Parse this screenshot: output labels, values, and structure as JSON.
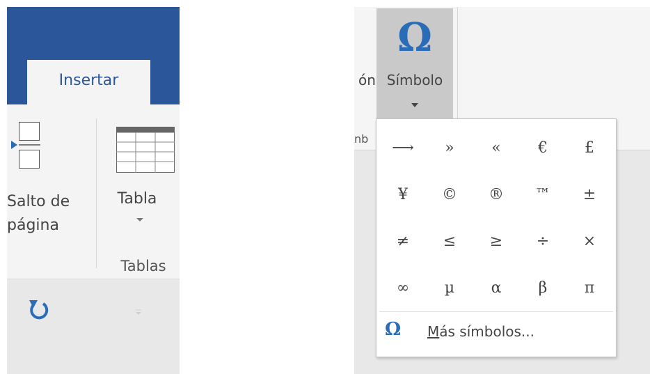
{
  "ribbon_left": {
    "tab_label": "Insertar",
    "page_break": {
      "label_line1": "Salto de",
      "label_line2": "página",
      "icon": "page-break-icon"
    },
    "table": {
      "label": "Tabla",
      "icon": "table-grid-icon"
    },
    "group_label": "Tablas",
    "quick_access": {
      "redo_icon": "redo-icon",
      "dropdown_icon": "chevron-down-icon"
    }
  },
  "ribbon_right": {
    "partial_left_label": "ón",
    "partial_group_label": "nb",
    "symbol_button": {
      "label": "Símbolo",
      "glyph": "Ω"
    }
  },
  "symbol_dropdown": {
    "symbols": [
      "⟶",
      "»",
      "«",
      "€",
      "£",
      "¥",
      "©",
      "®",
      "™",
      "±",
      "≠",
      "≤",
      "≥",
      "÷",
      "×",
      "∞",
      "µ",
      "α",
      "β",
      "π"
    ],
    "more_symbols": {
      "glyph": "Ω",
      "accel": "M",
      "rest": "ás símbolos..."
    }
  },
  "colors": {
    "accent": "#2b579a",
    "symbol_blue": "#2b6cb8",
    "button_pressed": "#c9c9c9"
  }
}
